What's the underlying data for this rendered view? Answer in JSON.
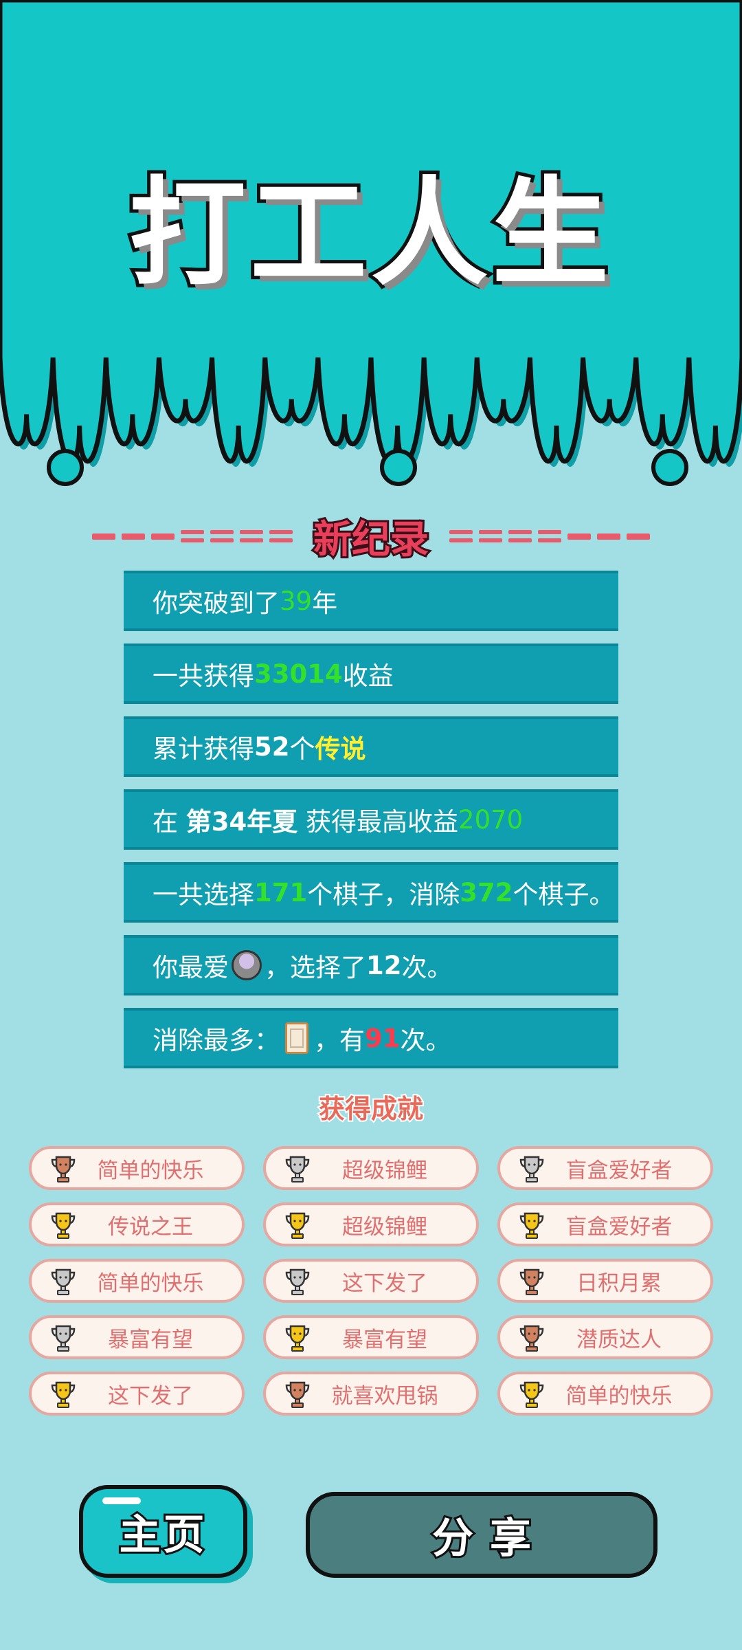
{
  "title": "打工人生",
  "record_title": "新纪录",
  "stats": {
    "years": {
      "prefix": "你突破到了",
      "value": "39",
      "suffix": "年"
    },
    "income": {
      "prefix": "一共获得",
      "value": "33014",
      "suffix": "收益"
    },
    "legends": {
      "prefix": "累计获得",
      "value": "52",
      "mid": "个",
      "highlight": "传说"
    },
    "best": {
      "prefix": "在 ",
      "season": "第34年夏",
      "mid": " 获得最高收益",
      "value": "2070"
    },
    "pieces": {
      "prefix": "一共选择",
      "selected": "171",
      "mid1": "个棋子，消除",
      "removed": "372",
      "suffix": "个棋子。"
    },
    "favorite": {
      "prefix": "你最爱",
      "mid": "，选择了",
      "count": "12",
      "suffix": "次。",
      "icon": "pot-icon"
    },
    "most_removed": {
      "prefix": "消除最多：",
      "mid": "，有",
      "count": "91",
      "suffix": "次。",
      "icon": "tile-icon"
    }
  },
  "achievements_title": "获得成就",
  "achievements": [
    {
      "label": "简单的快乐",
      "tier": "bronze"
    },
    {
      "label": "超级锦鲤",
      "tier": "silver"
    },
    {
      "label": "盲盒爱好者",
      "tier": "silver"
    },
    {
      "label": "传说之王",
      "tier": "gold"
    },
    {
      "label": "超级锦鲤",
      "tier": "gold"
    },
    {
      "label": "盲盒爱好者",
      "tier": "gold"
    },
    {
      "label": "简单的快乐",
      "tier": "silver"
    },
    {
      "label": "这下发了",
      "tier": "silver"
    },
    {
      "label": "日积月累",
      "tier": "bronze"
    },
    {
      "label": "暴富有望",
      "tier": "silver"
    },
    {
      "label": "暴富有望",
      "tier": "gold"
    },
    {
      "label": "潜质达人",
      "tier": "bronze"
    },
    {
      "label": "这下发了",
      "tier": "gold"
    },
    {
      "label": "就喜欢甩锅",
      "tier": "bronze"
    },
    {
      "label": "简单的快乐",
      "tier": "gold"
    }
  ],
  "buttons": {
    "home": "主页",
    "share": "分享"
  },
  "colors": {
    "top_band": "#15c6c7",
    "background": "#a2dfe5",
    "stat_row": "#109eb1",
    "accent_green": "#33e12a",
    "accent_yellow": "#ffef2e",
    "accent_red": "#ff3a4c",
    "record_red": "#ea3f5a",
    "gold": "#f5c518",
    "silver": "#c9c9c9",
    "bronze": "#d2825f"
  }
}
